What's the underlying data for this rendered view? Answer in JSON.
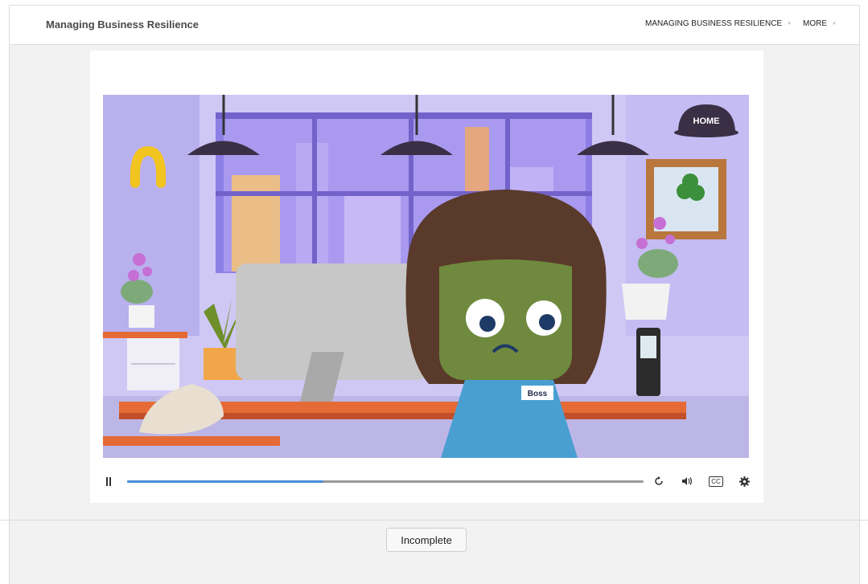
{
  "header": {
    "course_title": "Managing Business Resilience",
    "nav": [
      {
        "label": "MANAGING BUSINESS RESILIENCE",
        "icon": "chevron-down-icon"
      },
      {
        "label": "MORE",
        "icon": "chevron-down-icon"
      }
    ]
  },
  "video": {
    "scene": {
      "home_sign": "HOME",
      "name_badge": "Boss"
    },
    "controls": {
      "progress_fraction": 0.38,
      "icons": [
        "pause-icon",
        "replay-icon",
        "volume-icon",
        "closed-captions-icon",
        "settings-icon"
      ],
      "cc_label": "CC"
    }
  },
  "footer": {
    "status_label": "Incomplete"
  },
  "colors": {
    "progress_fill": "#4a8fd8",
    "progress_track": "#9a9a9a",
    "background": "#f2f2f2"
  }
}
